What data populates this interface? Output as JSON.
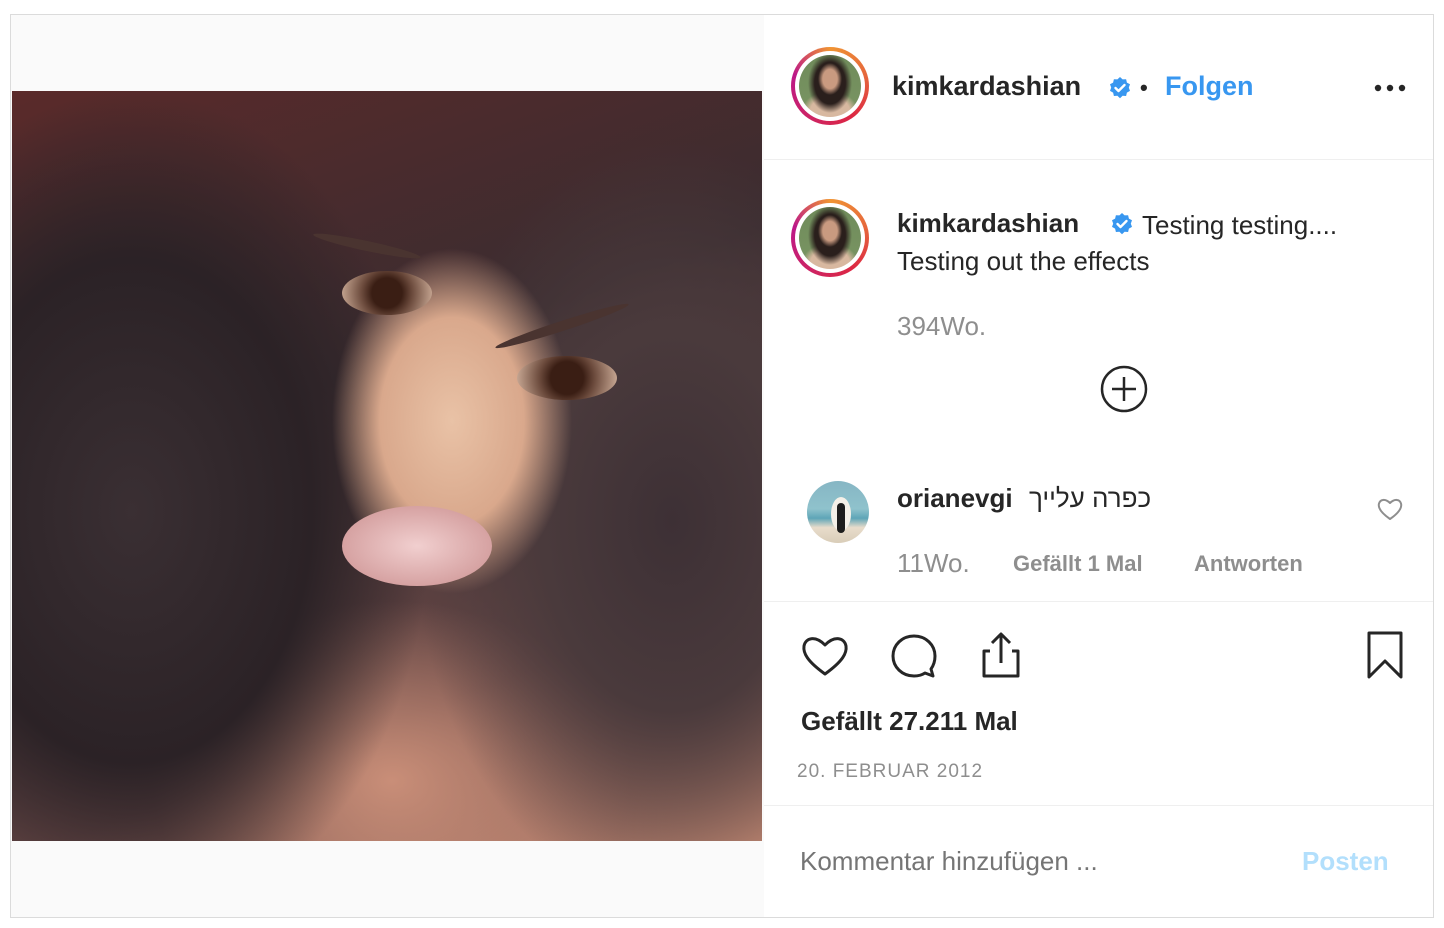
{
  "post": {
    "author": {
      "username": "kimkardashian",
      "verified_icon": "verified-badge-icon",
      "separator": "•",
      "follow_label": "Folgen"
    },
    "more_icon": "more-options-icon",
    "caption": {
      "username": "kimkardashian",
      "text": "Testing testing.... Testing out the effects",
      "time": "394Wo."
    },
    "load_more_icon": "plus-circle-icon",
    "comments": [
      {
        "username": "orianevgi",
        "text": "כפרה עלייך",
        "time": "11Wo.",
        "likes_label": "Gefällt 1 Mal",
        "reply_label": "Antworten",
        "heart_icon": "heart-outline-icon"
      }
    ],
    "actions": {
      "like_icon": "heart-icon",
      "comment_icon": "comment-icon",
      "share_icon": "share-icon",
      "save_icon": "bookmark-icon"
    },
    "likes_text": "Gefällt 27.211 Mal",
    "date": "20. FEBRUAR 2012",
    "comment_input": {
      "placeholder": "Kommentar hinzufügen ...",
      "post_label": "Posten"
    },
    "colors": {
      "link": "#3897f0",
      "verified": "#3897f0",
      "muted": "#8e8e8e",
      "post_disabled": "#b2dffc"
    }
  }
}
